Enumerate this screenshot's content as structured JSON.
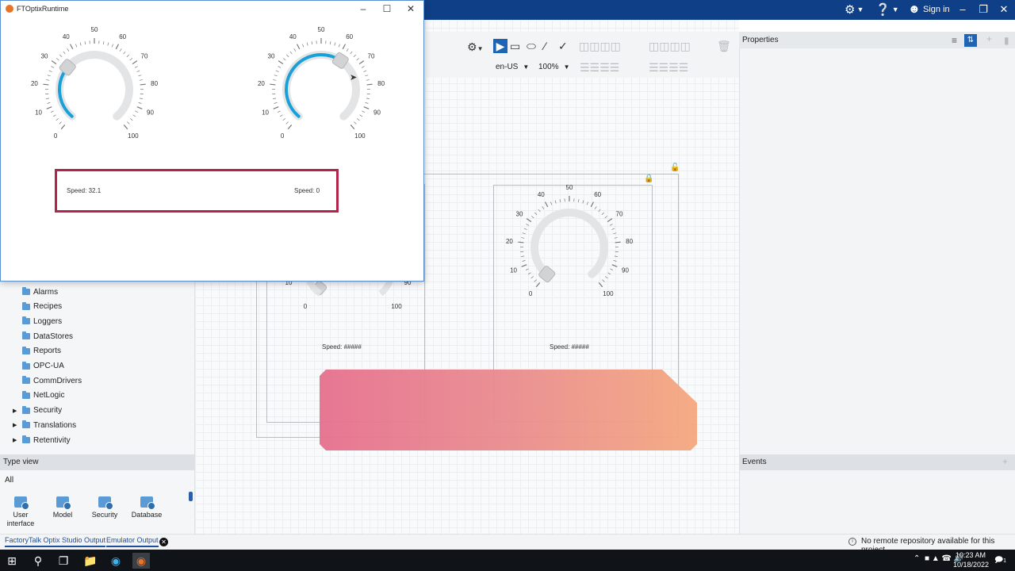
{
  "app": {
    "topbar": {
      "settings_icon": "gear-icon",
      "help_icon": "help-icon",
      "user_icon": "user-icon",
      "signin_label": "Sign in"
    }
  },
  "runtime_window": {
    "title": "FTOptixRuntime",
    "gauge_ticks": [
      "0",
      "10",
      "20",
      "30",
      "40",
      "50",
      "60",
      "70",
      "80",
      "90",
      "100"
    ],
    "gauges": [
      {
        "value": 32.1,
        "min": 0,
        "max": 100
      },
      {
        "value": 62,
        "min": 0,
        "max": 100
      }
    ],
    "speed_left": "Speed: 32.1",
    "speed_right": "Speed: 0",
    "accent": "#1aa0d8",
    "highlight_color": "#b3244b"
  },
  "toolbar": {
    "locale": "en-US",
    "zoom": "100%"
  },
  "project_tree": {
    "items": [
      {
        "label": "Alarms",
        "expandable": false
      },
      {
        "label": "Recipes",
        "expandable": false
      },
      {
        "label": "Loggers",
        "expandable": false
      },
      {
        "label": "DataStores",
        "expandable": false
      },
      {
        "label": "Reports",
        "expandable": false
      },
      {
        "label": "OPC-UA",
        "expandable": false
      },
      {
        "label": "CommDrivers",
        "expandable": false
      },
      {
        "label": "NetLogic",
        "expandable": false
      },
      {
        "label": "Security",
        "expandable": true
      },
      {
        "label": "Translations",
        "expandable": true
      },
      {
        "label": "Retentivity",
        "expandable": true
      }
    ]
  },
  "type_view": {
    "header": "Type view",
    "filter": "All",
    "items": [
      {
        "label": "User interface"
      },
      {
        "label": "Model"
      },
      {
        "label": "Security"
      },
      {
        "label": "Database"
      }
    ]
  },
  "canvas": {
    "gauge_ticks": [
      "0",
      "10",
      "20",
      "30",
      "40",
      "50",
      "60",
      "70",
      "80",
      "90",
      "100"
    ],
    "partial_ticks": [
      "10",
      "90",
      "0",
      "100"
    ],
    "speed_label_1": "Speed: #####",
    "speed_label_2": "Speed: #####",
    "banner_colors": [
      "#e6708e",
      "#f5a87f"
    ]
  },
  "properties": {
    "header": "Properties"
  },
  "events": {
    "header": "Events"
  },
  "output": {
    "tabs": [
      "FactoryTalk Optix Studio Output",
      "Emulator Output"
    ],
    "status_message": "No remote repository available for this project."
  },
  "taskbar": {
    "time": "10:23 AM",
    "date": "10/18/2022",
    "notification_count": "1"
  }
}
